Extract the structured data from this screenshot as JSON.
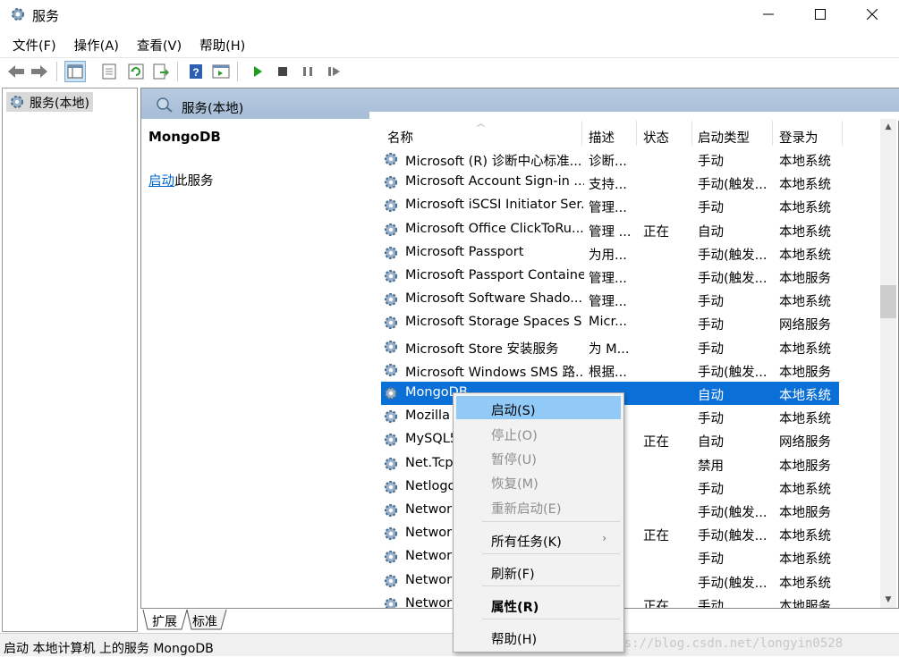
{
  "window": {
    "title": "服务",
    "min_glyph": "—",
    "max_glyph": "☐",
    "close_glyph": "✕"
  },
  "menu": [
    "文件(F)",
    "操作(A)",
    "查看(V)",
    "帮助(H)"
  ],
  "toolbar_icons": [
    "back-icon",
    "forward-icon",
    "console-tree-icon",
    "properties-sheet-icon",
    "refresh-icon",
    "export-icon",
    "help-icon",
    "console-icon",
    "play-icon",
    "stop-icon",
    "pause-icon",
    "restart-icon"
  ],
  "tree": {
    "root_label": "服务(本地)"
  },
  "pane": {
    "header": "服务(本地)",
    "detail_name": "MongoDB",
    "start_link": "启动",
    "start_suffix": "此服务"
  },
  "columns": [
    "名称",
    "描述",
    "状态",
    "启动类型",
    "登录为"
  ],
  "rows": [
    {
      "name": "Microsoft (R) 诊断中心标准...",
      "desc": "诊断...",
      "status": "",
      "start": "手动",
      "logon": "本地系统"
    },
    {
      "name": "Microsoft Account Sign-in ...",
      "desc": "支持...",
      "status": "",
      "start": "手动(触发...",
      "logon": "本地系统"
    },
    {
      "name": "Microsoft iSCSI Initiator Ser...",
      "desc": "管理...",
      "status": "",
      "start": "手动",
      "logon": "本地系统"
    },
    {
      "name": "Microsoft Office ClickToRu...",
      "desc": "管理 ...",
      "status": "正在",
      "start": "自动",
      "logon": "本地系统"
    },
    {
      "name": "Microsoft Passport",
      "desc": "为用...",
      "status": "",
      "start": "手动(触发...",
      "logon": "本地系统"
    },
    {
      "name": "Microsoft Passport Container",
      "desc": "管理...",
      "status": "",
      "start": "手动(触发...",
      "logon": "本地服务"
    },
    {
      "name": "Microsoft Software Shado...",
      "desc": "管理...",
      "status": "",
      "start": "手动",
      "logon": "本地系统"
    },
    {
      "name": "Microsoft Storage Spaces S",
      "desc": "Micr...",
      "status": "",
      "start": "手动",
      "logon": "网络服务"
    },
    {
      "name": "Microsoft Store 安装服务",
      "desc": "为 M...",
      "status": "",
      "start": "手动",
      "logon": "本地系统"
    },
    {
      "name": "Microsoft Windows SMS 路...",
      "desc": "根据...",
      "status": "",
      "start": "手动(触发...",
      "logon": "本地服务"
    },
    {
      "name": "MongoDB",
      "desc": "",
      "status": "",
      "start": "自动",
      "logon": "本地系统",
      "selected": true
    },
    {
      "name": "Mozilla",
      "desc": "...",
      "status": "",
      "start": "手动",
      "logon": "本地系统"
    },
    {
      "name": "MySQL5",
      "desc": "",
      "status": "正在",
      "start": "自动",
      "logon": "网络服务"
    },
    {
      "name": "Net.Tcp",
      "desc": "",
      "status": "",
      "start": "禁用",
      "logon": "本地服务"
    },
    {
      "name": "Netlogo",
      "desc": "",
      "status": "",
      "start": "手动",
      "logon": "本地系统"
    },
    {
      "name": "Networ",
      "desc": "",
      "status": "",
      "start": "手动(触发...",
      "logon": "本地服务"
    },
    {
      "name": "Networ",
      "desc": "",
      "status": "正在",
      "start": "手动(触发...",
      "logon": "本地系统"
    },
    {
      "name": "Networ",
      "desc": "...",
      "status": "",
      "start": "手动",
      "logon": "本地系统"
    },
    {
      "name": "Networ",
      "desc": "...",
      "status": "",
      "start": "手动(触发...",
      "logon": "本地系统"
    },
    {
      "name": "Networ",
      "desc": "",
      "status": "正在",
      "start": "手动",
      "logon": "本地服务"
    }
  ],
  "context_menu": {
    "start": "启动(S)",
    "stop": "停止(O)",
    "pause": "暂停(U)",
    "resume": "恢复(M)",
    "restart": "重新启动(E)",
    "all_tasks": "所有任务(K)",
    "all_tasks_arrow": "›",
    "refresh": "刷新(F)",
    "properties": "属性(R)",
    "help": "帮助(H)"
  },
  "tabs": [
    "扩展",
    "标准"
  ],
  "status_text": "启动 本地计算机 上的服务 MongoDB",
  "watermark": "https://blog.csdn.net/longyin0528",
  "colors": {
    "selection": "#0a70d8",
    "menu_highlight": "#91c9f7",
    "header_blue": "#b8cbe0",
    "link": "#0066cc"
  }
}
